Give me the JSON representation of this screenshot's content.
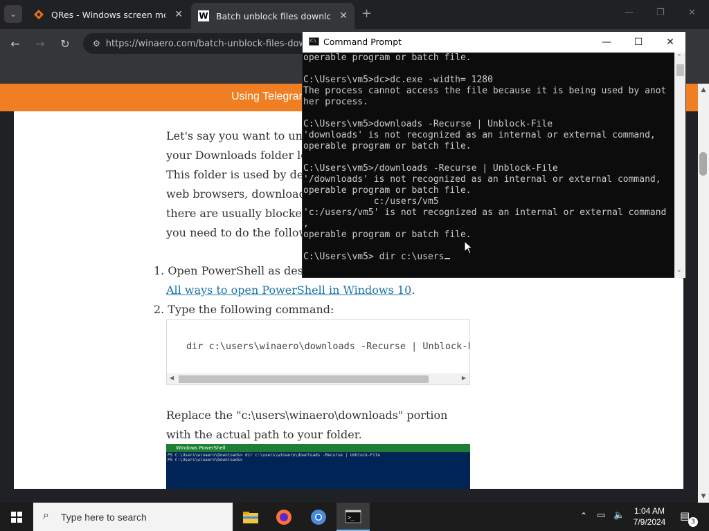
{
  "browser": {
    "tabs": [
      {
        "title": "QRes - Windows screen mode",
        "close": "✕"
      },
      {
        "title": "Batch unblock files downloade",
        "close": "✕"
      }
    ],
    "new_tab": "+",
    "url": "https://winaero.com/batch-unblock-files-dow",
    "window_controls": {
      "minimize": "—",
      "maximize": "❐",
      "close": "✕"
    }
  },
  "page": {
    "banner": "Using Telegram",
    "intro_lines": [
      "Let's say you want to unb",
      "your Downloads folder lo",
      "This folder is used by def",
      "web browsers, download",
      "there are usually blocked",
      "you need to do the follow"
    ],
    "step1_prefix": "Open PowerShell as desc",
    "step1_link": "All ways to open PowerShell in Windows 10",
    "step1_suffix": ".",
    "step2": "Type the following command:",
    "code": "dir c:\\users\\winaero\\downloads -Recurse | Unblock-F",
    "replace_line1": "Replace the \"c:\\users\\winaero\\downloads\" portion",
    "replace_line2": "with the actual path to your folder.",
    "ps_title": "Windows PowerShell",
    "ps_lines": [
      "PS C:\\Users\\winaero\\Downloads> dir c:\\users\\winaero\\downloads -Recurse | Unblock-File",
      "PS C:\\Users\\winaero\\Downloads>"
    ]
  },
  "cmd": {
    "title": "Command Prompt",
    "lines": [
      "operable program or batch file.",
      "",
      "C:\\Users\\vm5>dc>dc.exe -width= 1280",
      "The process cannot access the file because it is being used by anot",
      "her process.",
      "",
      "C:\\Users\\vm5>downloads -Recurse | Unblock-File",
      "'downloads' is not recognized as an internal or external command,",
      "operable program or batch file.",
      "",
      "C:\\Users\\vm5>/downloads -Recurse | Unblock-File",
      "'/downloads' is not recognized as an internal or external command,",
      "operable program or batch file.",
      "             c:/users/vm5",
      "'c:/users/vm5' is not recognized as an internal or external command",
      ",",
      "operable program or batch file.",
      "",
      "C:\\Users\\vm5> dir c:\\users"
    ]
  },
  "taskbar": {
    "search_placeholder": "Type here to search",
    "time": "1:04 AM",
    "date": "7/9/2024",
    "notification_count": "3"
  }
}
